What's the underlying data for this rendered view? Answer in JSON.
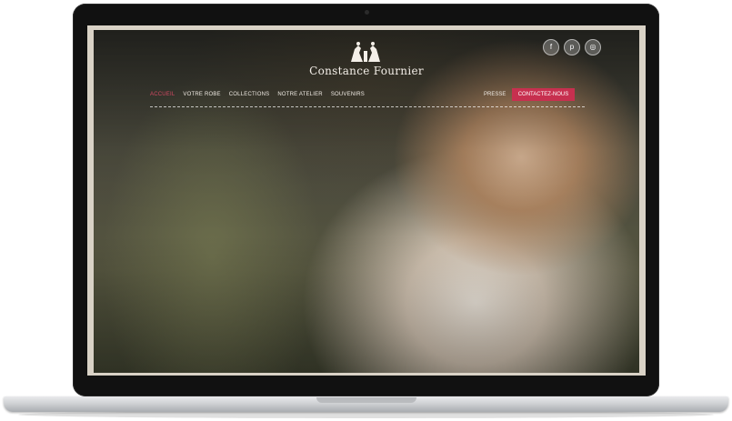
{
  "site": {
    "brand": "Constance Fournier",
    "nav_items": [
      {
        "label": "ACCUEIL",
        "active": true
      },
      {
        "label": "VOTRE ROBE",
        "active": false
      },
      {
        "label": "COLLECTIONS",
        "active": false
      },
      {
        "label": "NOTRE ATELIER",
        "active": false
      },
      {
        "label": "SOUVENIRS",
        "active": false
      }
    ],
    "presse": "PRESSE",
    "contact": "CONTACTEZ-NOUS",
    "socials": [
      {
        "icon": "facebook-icon",
        "glyph": "f"
      },
      {
        "icon": "pinterest-icon",
        "glyph": "p"
      },
      {
        "icon": "instagram-icon",
        "glyph": "◎"
      }
    ]
  },
  "colors": {
    "accent": "#c7304f",
    "active_nav": "#d34a63",
    "laptop_bezel": "#111111"
  }
}
